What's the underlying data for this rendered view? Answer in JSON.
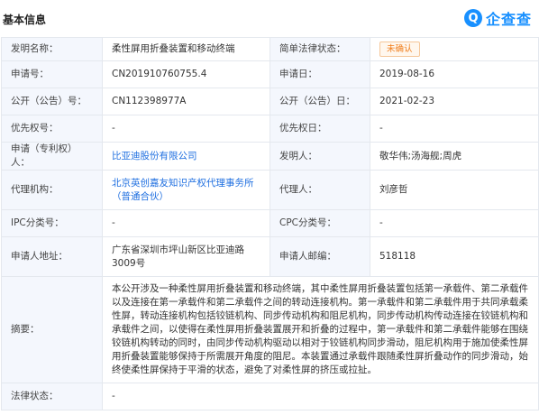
{
  "header": {
    "title": "基本信息",
    "logo_glyph": "Q",
    "logo_text": "企查查"
  },
  "rows": {
    "invention_name_label": "发明名称：",
    "invention_name": "柔性屏用折叠装置和移动终端",
    "legal_status_simple_label": "简单法律状态：",
    "legal_status_simple": "未确认",
    "app_no_label": "申请号：",
    "app_no": "CN201910760755.4",
    "app_date_label": "申请日：",
    "app_date": "2019-08-16",
    "pub_no_label": "公开（公告）号：",
    "pub_no": "CN112398977A",
    "pub_date_label": "公开（公告）日：",
    "pub_date": "2021-02-23",
    "priority_no_label": "优先权号：",
    "priority_no": "-",
    "priority_date_label": "优先权日：",
    "priority_date": "-",
    "applicant_label": "申请（专利权）人：",
    "applicant": "比亚迪股份有限公司",
    "inventor_label": "发明人：",
    "inventor": "敬华伟;汤海舰;周虎",
    "agency_label": "代理机构：",
    "agency": "北京英创嘉友知识产权代理事务所（普通合伙）",
    "agent_label": "代理人：",
    "agent": "刘彦哲",
    "ipc_label": "IPC分类号：",
    "ipc": "-",
    "cpc_label": "CPC分类号：",
    "cpc": "-",
    "address_label": "申请人地址：",
    "address": "广东省深圳市坪山新区比亚迪路3009号",
    "postcode_label": "申请人邮编：",
    "postcode": "518118",
    "abstract_label": "摘要：",
    "abstract": "本公开涉及一种柔性屏用折叠装置和移动终端，其中柔性屏用折叠装置包括第一承载件、第二承载件以及连接在第一承载件和第二承载件之间的转动连接机构。第一承载件和第二承载件用于共同承载柔性屏，转动连接机构包括铰链机构、同步传动机构和阻尼机构，同步传动机构传动连接在铰链机构和承载件之间，以使得在柔性屏用折叠装置展开和折叠的过程中，第一承载件和第二承载件能够在围绕铰链机构转动的同时，由同步传动机构驱动以相对于铰链机构同步滑动，阻尼机构用于施加使柔性屏用折叠装置能够保持于所需展开角度的阻尼。本装置通过承载件跟随柔性屏折叠动作的同步滑动，始终使柔性屏保持于平滑的状态，避免了对柔性屏的挤压或拉扯。",
    "legal_status_label": "法律状态：",
    "legal_status": "-"
  },
  "colors": {
    "label_bg": "#f4f7fd",
    "border": "#e4e8ee",
    "link": "#1f6fe0",
    "badge": "#f07d1a"
  }
}
